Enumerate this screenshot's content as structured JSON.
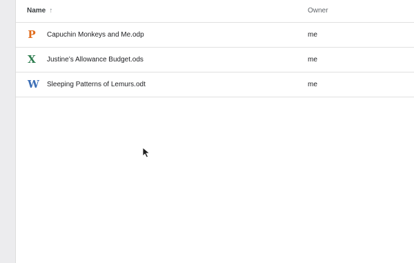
{
  "columns": {
    "name_label": "Name",
    "sort_indicator": "↑",
    "owner_label": "Owner"
  },
  "files": [
    {
      "icon": "presentation-icon",
      "icon_glyph": "P",
      "icon_color": "#e06c1c",
      "name": "Capuchin Monkeys and Me.odp",
      "owner": "me"
    },
    {
      "icon": "spreadsheet-icon",
      "icon_glyph": "X",
      "icon_color": "#2e7d4f",
      "name": "Justine’s Allowance Budget.ods",
      "owner": "me"
    },
    {
      "icon": "document-icon",
      "icon_glyph": "W",
      "icon_color": "#3d6fb6",
      "name": "Sleeping Patterns of Lemurs.odt",
      "owner": "me"
    }
  ],
  "colors": {
    "rail": "#ececee",
    "divider": "#e0e0e0"
  }
}
